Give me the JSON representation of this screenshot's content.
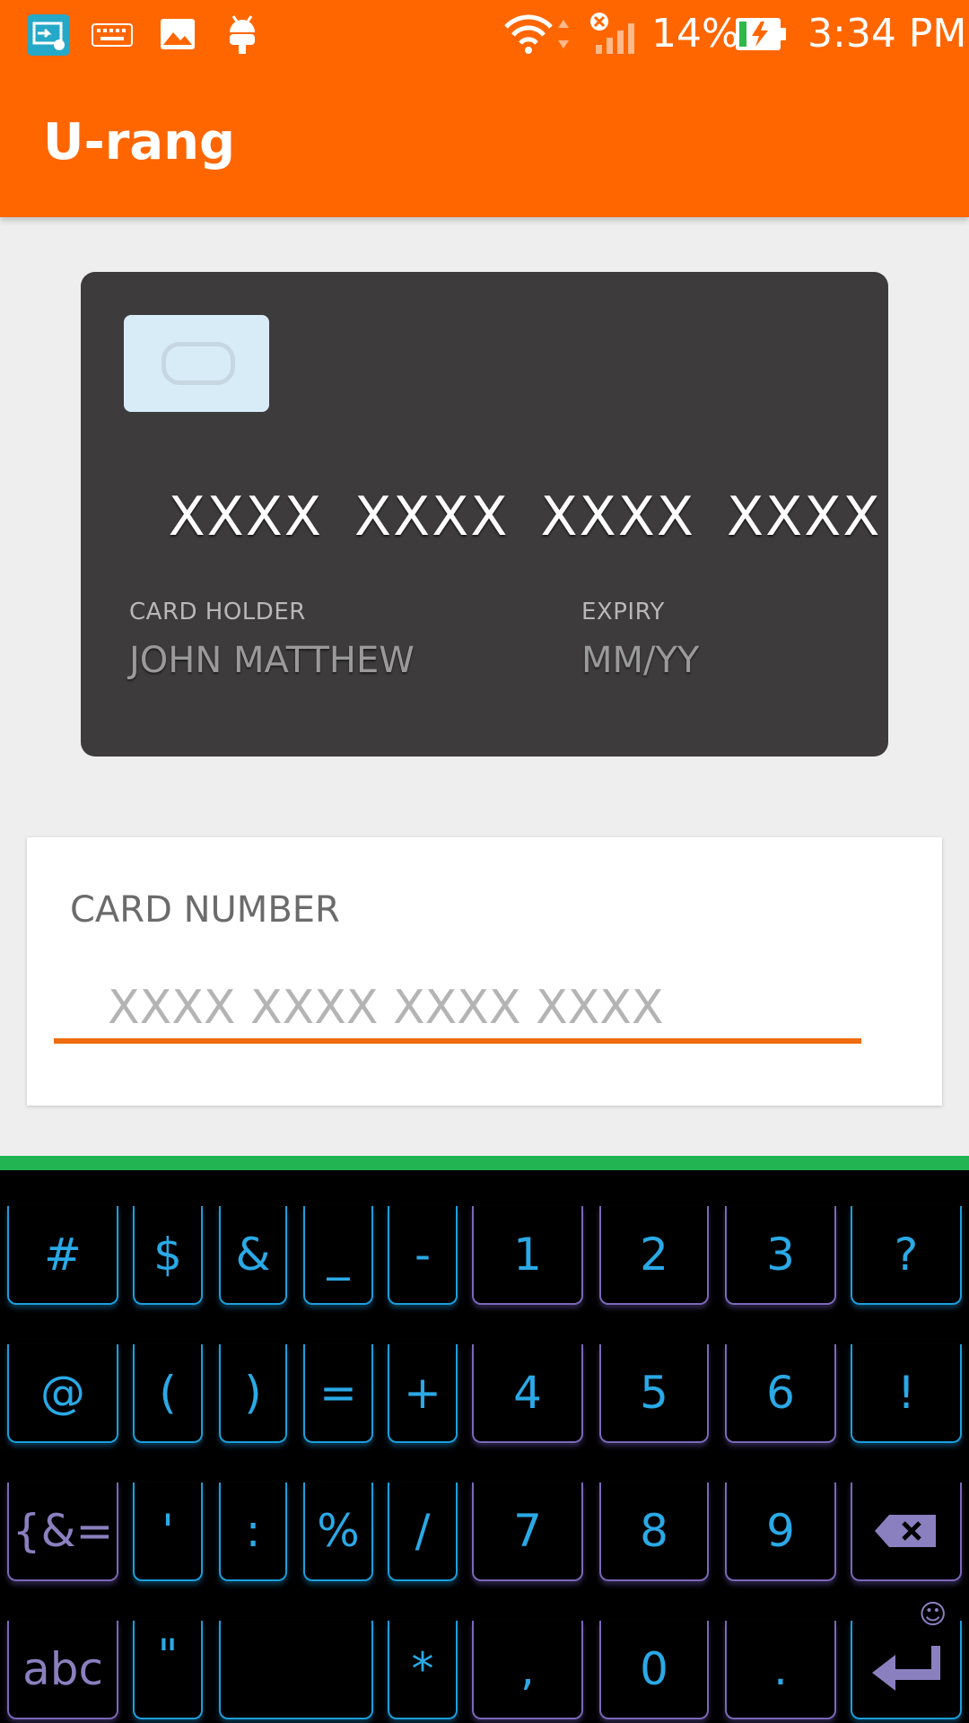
{
  "status_bar": {
    "battery": "14%",
    "time": "3:34 PM",
    "icons": [
      "screen-cast-icon",
      "keyboard-icon",
      "image-icon",
      "android-icon",
      "wifi-icon",
      "signal-icon",
      "battery-charging-icon"
    ]
  },
  "app": {
    "title": "U-rang",
    "accent": "#ff6600"
  },
  "card": {
    "number": "XXXX  XXXX  XXXX  XXXX",
    "holder_label": "CARD HOLDER",
    "holder_value": "JOHN MATTHEW",
    "expiry_label": "EXPIRY",
    "expiry_value": "MM/YY"
  },
  "input": {
    "label": "CARD NUMBER",
    "placeholder": "XXXX XXXX XXXX XXXX",
    "value": ""
  },
  "keyboard": {
    "rows": [
      [
        "#",
        "$",
        "&",
        "_",
        "-",
        "1",
        "2",
        "3",
        "?"
      ],
      [
        "@",
        "(",
        ")",
        "=",
        "+",
        "4",
        "5",
        "6",
        "!"
      ],
      [
        "{&=",
        "'",
        ":",
        "%",
        "/",
        "7",
        "8",
        "9",
        "⌫"
      ],
      [
        "abc",
        "\"",
        "",
        "*",
        ",",
        "0",
        ".",
        "↵"
      ]
    ],
    "emoji": "☺"
  }
}
